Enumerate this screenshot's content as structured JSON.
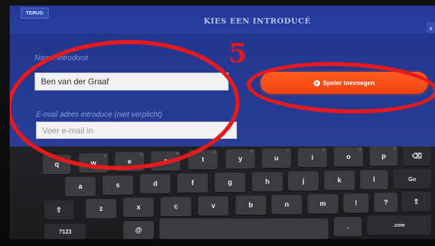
{
  "header": {
    "back_label": "TERUG",
    "title": "KIES EEN INTRODUCÉ"
  },
  "form": {
    "name_label": "Naam introducé",
    "name_value": "Ben van der Graaf",
    "email_label": "E-mail adres introduce (niet verplicht)",
    "email_placeholder": "Voer e-mail in",
    "add_button_label": "Speler toevoegen"
  },
  "annotation": {
    "step_number": "5"
  },
  "keyboard": {
    "row1": [
      {
        "label": "q"
      },
      {
        "label": "w",
        "hint": "2"
      },
      {
        "label": "e",
        "hint": "3"
      },
      {
        "label": "r",
        "hint": "4"
      },
      {
        "label": "t",
        "hint": "5"
      },
      {
        "label": "y",
        "hint": "6"
      },
      {
        "label": "u",
        "hint": "7"
      },
      {
        "label": "i",
        "hint": "8"
      },
      {
        "label": "o",
        "hint": "9"
      },
      {
        "label": "p",
        "hint": "0"
      },
      {
        "label": "⌫"
      }
    ],
    "row2": [
      {
        "label": "a"
      },
      {
        "label": "s"
      },
      {
        "label": "d"
      },
      {
        "label": "f"
      },
      {
        "label": "g"
      },
      {
        "label": "h"
      },
      {
        "label": "j"
      },
      {
        "label": "k"
      },
      {
        "label": "l"
      },
      {
        "label": "Go"
      }
    ],
    "row3": [
      {
        "label": "⇧"
      },
      {
        "label": "z"
      },
      {
        "label": "x"
      },
      {
        "label": "c"
      },
      {
        "label": "v"
      },
      {
        "label": "b"
      },
      {
        "label": "n"
      },
      {
        "label": "m"
      },
      {
        "label": "!"
      },
      {
        "label": "?"
      },
      {
        "label": "⇧"
      }
    ],
    "row4": [
      {
        "label": "?123"
      },
      {
        "label": "@"
      },
      {
        "label": ""
      },
      {
        "label": "."
      },
      {
        "label": ".com"
      }
    ]
  },
  "colors": {
    "screen_bg": "#1e2f79",
    "accent": "#f04410",
    "annotation_red": "#e51a1d",
    "keyboard_bg": "#1b1c1e"
  }
}
